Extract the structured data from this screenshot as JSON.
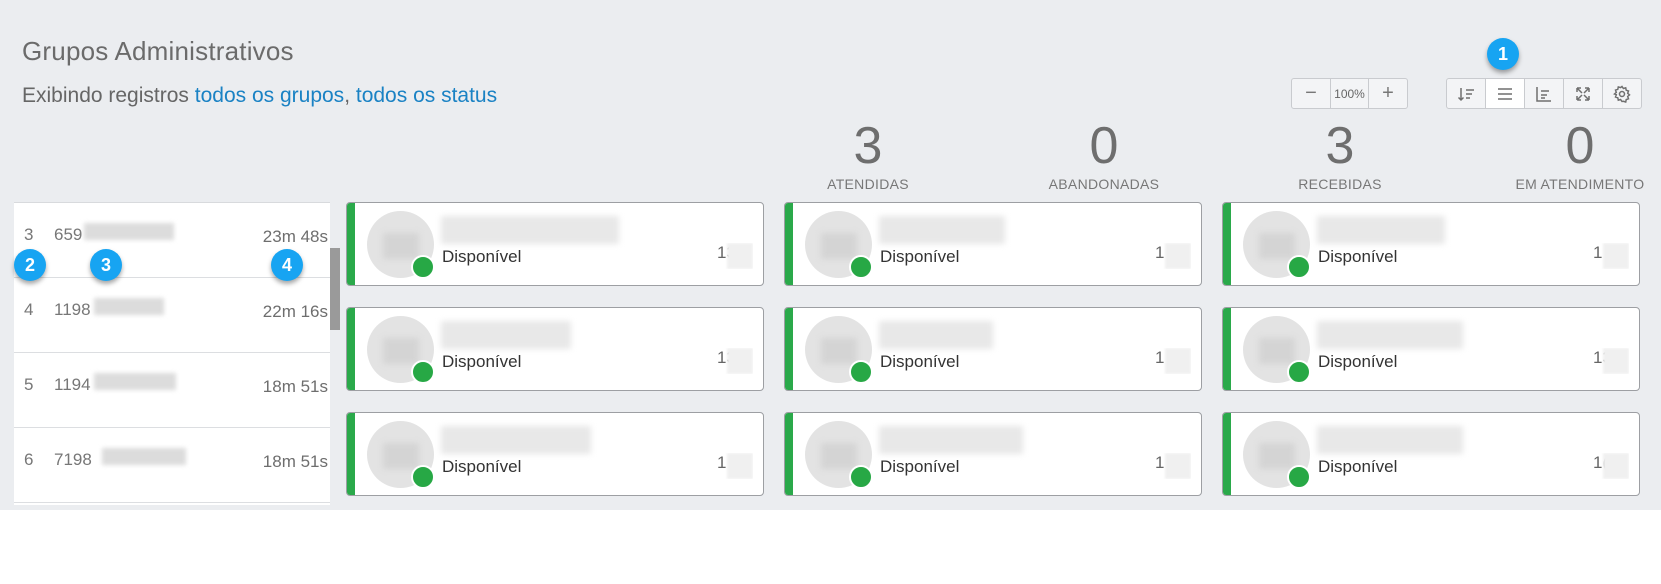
{
  "header": {
    "title": "Grupos Administrativos",
    "subtitle_prefix": "Exibindo registros ",
    "filter_groups": "todos os grupos",
    "separator": ", ",
    "filter_status": "todos os status"
  },
  "zoom": {
    "minus": "−",
    "value": "100%",
    "plus": "+"
  },
  "toolbar": {
    "buttons": [
      {
        "name": "sort-icon"
      },
      {
        "name": "list-view-icon"
      },
      {
        "name": "chart-icon"
      },
      {
        "name": "fullscreen-icon"
      },
      {
        "name": "gear-icon"
      }
    ]
  },
  "callouts": [
    "1",
    "2",
    "3",
    "4"
  ],
  "stats": [
    {
      "value": "3",
      "label": "ATENDIDAS"
    },
    {
      "value": "0",
      "label": "ABANDONADAS"
    },
    {
      "value": "3",
      "label": "RECEBIDAS"
    },
    {
      "value": "0",
      "label": "EM ATENDIMENTO"
    }
  ],
  "queue": [
    {
      "position": "3",
      "phone": "659",
      "wait": "23m 48s"
    },
    {
      "position": "4",
      "phone": "1198",
      "wait": "22m 16s"
    },
    {
      "position": "5",
      "phone": "1194",
      "wait": "18m 51s"
    },
    {
      "position": "6",
      "phone": "7198",
      "wait": "18m 51s"
    }
  ],
  "agents": [
    {
      "status": "Disponível",
      "time": "13",
      "status_color": "#27a845"
    },
    {
      "status": "Disponível",
      "time": "1",
      "status_color": "#27a845"
    },
    {
      "status": "Disponível",
      "time": "1",
      "status_color": "#27a845"
    },
    {
      "status": "Disponível",
      "time": "13",
      "status_color": "#27a845"
    },
    {
      "status": "Disponível",
      "time": "1",
      "status_color": "#27a845"
    },
    {
      "status": "Disponível",
      "time": "13",
      "status_color": "#27a845"
    },
    {
      "status": "Disponível",
      "time": "1",
      "status_color": "#27a845"
    },
    {
      "status": "Disponível",
      "time": "1",
      "status_color": "#27a845"
    },
    {
      "status": "Disponível",
      "time": "1(",
      "status_color": "#27a845"
    }
  ]
}
